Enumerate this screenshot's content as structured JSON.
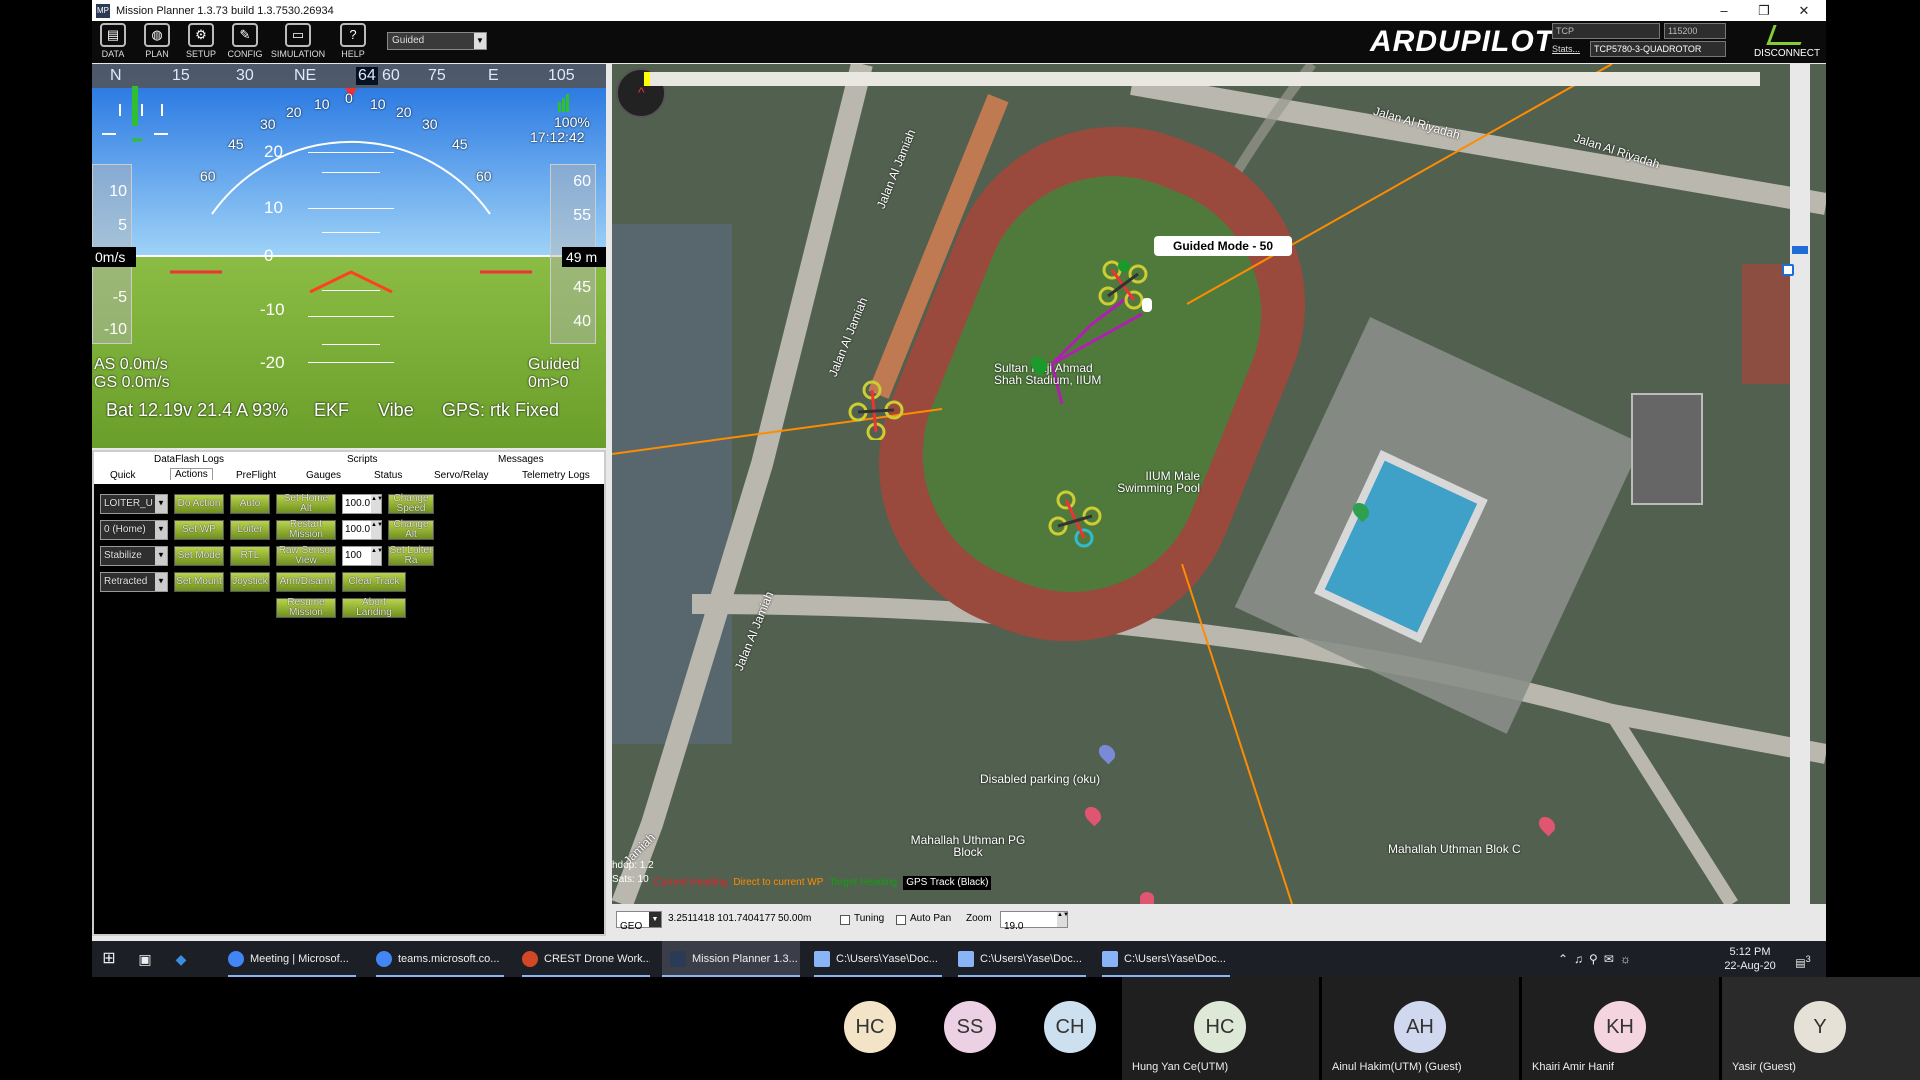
{
  "window": {
    "title": "Mission Planner 1.3.73 build 1.3.7530.26934",
    "controls": [
      "–",
      "❐",
      "✕"
    ]
  },
  "toolbar": {
    "buttons": [
      {
        "label": "DATA",
        "icon": "data-icon"
      },
      {
        "label": "PLAN",
        "icon": "globe-icon"
      },
      {
        "label": "SETUP",
        "icon": "gear-icon"
      },
      {
        "label": "CONFIG",
        "icon": "wrench-icon"
      },
      {
        "label": "SIMULATION",
        "icon": "simulation-icon"
      },
      {
        "label": "HELP",
        "icon": "help-icon"
      }
    ],
    "mode": "Guided",
    "logo": "ARDUPILOT",
    "connection_type": "TCP",
    "baud": "115200",
    "stats_link": "Stats...",
    "vehicle": "TCP5780-3-QUADROTOR",
    "disconnect_label": "DISCONNECT"
  },
  "hud": {
    "heading_labels": [
      "N",
      "15",
      "30",
      "NE",
      "60",
      "75",
      "E",
      "105"
    ],
    "heading_value": "64",
    "battery_pct": "100%",
    "time": "17:12:42",
    "speed_ticks": [
      "10",
      "5",
      "-5",
      "-10"
    ],
    "alt_ticks": [
      "60",
      "55",
      "45",
      "40"
    ],
    "pitch_left": [
      "20",
      "10",
      "0",
      "-10",
      "-20"
    ],
    "roll_ticks": [
      "60",
      "45",
      "30",
      "20",
      "10",
      "0",
      "10",
      "20",
      "30",
      "45",
      "60"
    ],
    "speed_box": "0m/s",
    "alt_box": "49 m",
    "airspeed": "AS 0.0m/s",
    "groundspeed": "GS 0.0m/s",
    "mode": "Guided",
    "dist": "0m>0",
    "battery": "Bat 12.19v 21.4 A 93%",
    "ekf": "EKF",
    "vibe": "Vibe",
    "gps": "GPS: rtk Fixed"
  },
  "tabs": {
    "row1": [
      "DataFlash Logs",
      "Scripts",
      "Messages"
    ],
    "row2": [
      "Quick",
      "Actions",
      "PreFlight",
      "Gauges",
      "Status",
      "Servo/Relay",
      "Telemetry Logs"
    ]
  },
  "actions": {
    "sel1": "LOITER_U",
    "sel2": "0 (Home)",
    "sel3": "Stabilize",
    "sel4": "Retracted",
    "do_action": "Do Action",
    "auto": "Auto",
    "set_home_alt": "Set Home Alt",
    "num1": "100.0",
    "change_speed": "Change Speed",
    "set_wp": "Set WP",
    "loiter": "Loiter",
    "restart_mission": "Restart Mission",
    "num2": "100.0",
    "change_alt": "Change Alt",
    "set_mode": "Set Mode",
    "rtl": "RTL",
    "raw_sensor_view": "Raw Sensor View",
    "num3": "100",
    "set_loiter_rad": "Set Loiter Ra",
    "set_mount": "Set Mount",
    "joystick": "Joystick",
    "arm_disarm": "Arm/Disarm",
    "clear_track": "Clear Track",
    "resume_mission": "Resume Mission",
    "abort_landing": "Abort Landing"
  },
  "map": {
    "streets": [
      "Jalan Al Riyadah",
      "Jalan Al Riyadah",
      "Jalan Al Jamiah",
      "Jalan Al Jamiah",
      "Jalan Al Jamiah",
      "Jamiah"
    ],
    "places": [
      "Sultan Haji Ahmad Shah Stadium, IIUM",
      "IIUM Male Swimming Pool",
      "Disabled parking (oku)",
      "Mahallah Uthman PG Block",
      "Mahallah Uthman Blok C"
    ],
    "guided_label": "Guided Mode - 50",
    "hdop": "hdop: 1.2",
    "sats": "Sats: 10",
    "legend": [
      "Current Heading",
      "Direct to current WP",
      "Target Heading",
      "GPS Track (Black)"
    ],
    "legend_colors": [
      "#e8202a",
      "#ff8c00",
      "#10a010",
      "#000000"
    ],
    "coord_type": "GEO",
    "coords": "3.2511418 101.7404177",
    "alt_readout": "50.00m",
    "tuning": "Tuning",
    "auto_pan": "Auto Pan",
    "zoom_label": "Zoom",
    "zoom": "19.0"
  },
  "taskbar": {
    "items": [
      {
        "label": "Meeting | Microsof...",
        "color": "#4285f4"
      },
      {
        "label": "teams.microsoft.co...",
        "color": "#4285f4"
      },
      {
        "label": "CREST Drone Work...",
        "color": "#d24726"
      },
      {
        "label": "Mission Planner 1.3...",
        "color": "#2b3b55"
      },
      {
        "label": "C:\\Users\\Yase\\Doc...",
        "color": "#8ab4f8"
      },
      {
        "label": "C:\\Users\\Yase\\Doc...",
        "color": "#8ab4f8"
      },
      {
        "label": "C:\\Users\\Yase\\Doc...",
        "color": "#8ab4f8"
      }
    ],
    "clock_time": "5:12 PM",
    "clock_date": "22-Aug-20",
    "notif_count": "3"
  },
  "participants": [
    {
      "initials": "HC",
      "name": "",
      "color": "#f3e3c7"
    },
    {
      "initials": "SS",
      "name": "",
      "color": "#ecd0e4"
    },
    {
      "initials": "CH",
      "name": "",
      "color": "#cde0ef"
    },
    {
      "initials": "HC",
      "name": "Hung Yan Ce(UTM)",
      "color": "#dde8d6"
    },
    {
      "initials": "AH",
      "name": "Ainul Hakim(UTM) (Guest)",
      "color": "#cfd8ee"
    },
    {
      "initials": "KH",
      "name": "Khairi Amir Hanif",
      "color": "#f4d4de"
    },
    {
      "initials": "Y",
      "name": "Yasir (Guest)",
      "color": "#e6e1d6"
    }
  ]
}
